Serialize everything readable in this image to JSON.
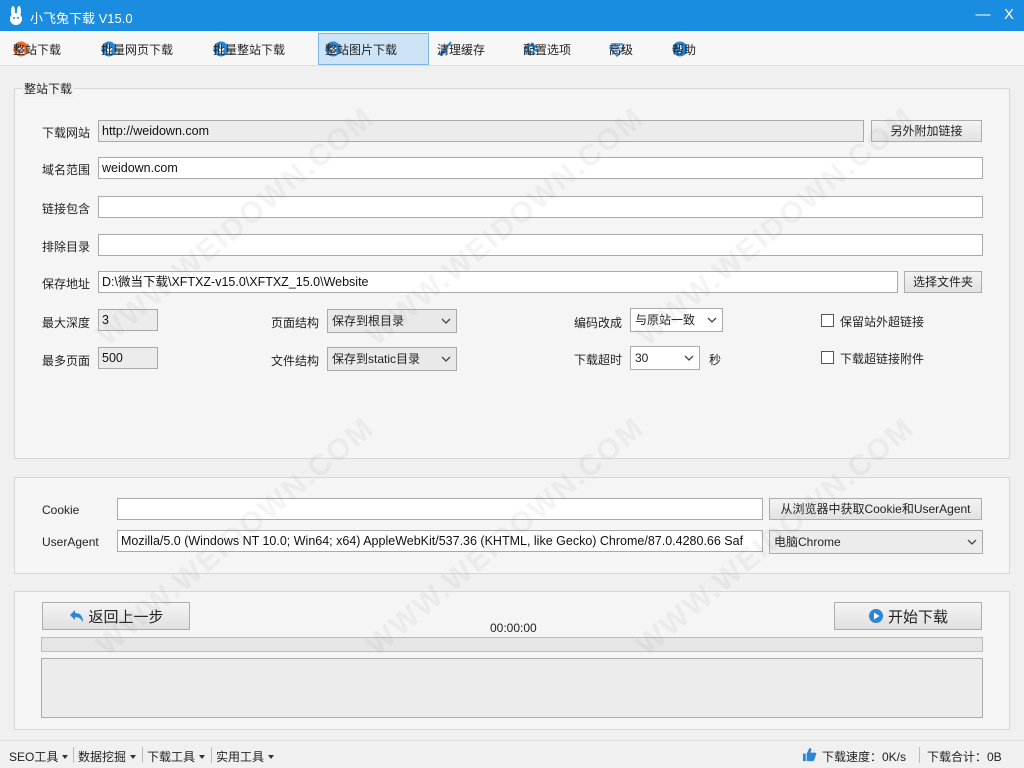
{
  "window": {
    "title": "小飞兔下载 V15.0",
    "minimize_glyph": "—",
    "close_glyph": "X"
  },
  "toolbar": {
    "items": [
      {
        "label": "整站下载",
        "icon": "download-orange-icon"
      },
      {
        "label": "批量网页下载",
        "icon": "download-blue-icon"
      },
      {
        "label": "批量整站下载",
        "icon": "download-blue-icon"
      },
      {
        "label": "整站图片下载",
        "icon": "download-blue-icon",
        "active": true
      },
      {
        "label": "清理缓存",
        "icon": "broom-icon"
      },
      {
        "label": "配置选项",
        "icon": "gear-icon"
      },
      {
        "label": "高级",
        "icon": "gem-icon"
      },
      {
        "label": "帮助",
        "icon": "help-icon"
      }
    ]
  },
  "site_group": {
    "legend": "整站下载",
    "download_url": {
      "label": "下载网站",
      "value": "http://weidown.com"
    },
    "extra_links_button": "另外附加链接",
    "domain_scope": {
      "label": "域名范围",
      "value": "weidown.com"
    },
    "link_include": {
      "label": "链接包含",
      "value": ""
    },
    "exclude_dir": {
      "label": "排除目录",
      "value": ""
    },
    "save_path": {
      "label": "保存地址",
      "value": "D:\\微当下载\\XFTXZ-v15.0\\XFTXZ_15.0\\Website"
    },
    "choose_folder_button": "选择文件夹",
    "max_depth": {
      "label": "最大深度",
      "value": "3"
    },
    "max_pages": {
      "label": "最多页面",
      "value": "500"
    },
    "page_structure": {
      "label": "页面结构",
      "value": "保存到根目录"
    },
    "file_structure": {
      "label": "文件结构",
      "value": "保存到static目录"
    },
    "encoding": {
      "label": "编码改成",
      "value": "与原站一致"
    },
    "timeout": {
      "label": "下载超时",
      "value": "30",
      "unit": "秒"
    },
    "keep_external": {
      "label": "保留站外超链接",
      "checked": false
    },
    "download_attachments": {
      "label": "下载超链接附件",
      "checked": false
    }
  },
  "http_group": {
    "cookie": {
      "label": "Cookie",
      "value": ""
    },
    "get_cookie_button": "从浏览器中获取Cookie和UserAgent",
    "useragent": {
      "label": "UserAgent",
      "value": "Mozilla/5.0 (Windows NT 10.0; Win64; x64) AppleWebKit/537.36 (KHTML, like Gecko) Chrome/87.0.4280.66 Saf"
    },
    "ua_preset": "电脑Chrome"
  },
  "actions": {
    "back_button": "返回上一步",
    "start_button": "开始下载",
    "elapsed": "00:00:00",
    "progress": 0
  },
  "statusbar": {
    "menus": [
      "SEO工具",
      "数据挖掘",
      "下载工具",
      "实用工具"
    ],
    "speed": "下载速度：0K/s",
    "total": "下载合计：0B"
  },
  "watermark": "WWW.WEIDOWN.COM",
  "colors": {
    "titlebar": "#1b8de0",
    "accent": "#3c9be6",
    "active_tab": "#cde4f7"
  }
}
